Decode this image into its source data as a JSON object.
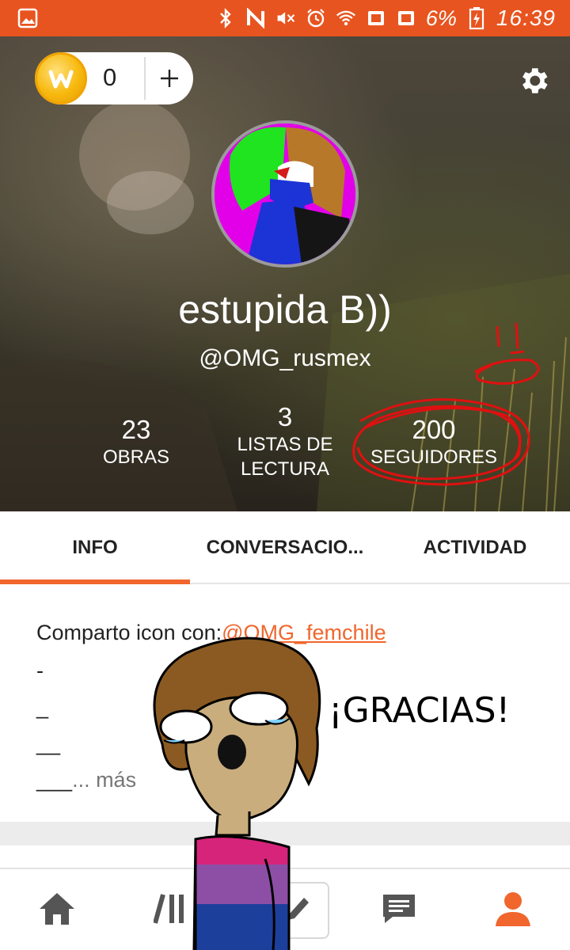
{
  "status_bar": {
    "battery": "6%",
    "time": "16:39",
    "icons": [
      "gallery-icon",
      "bluetooth-icon",
      "nfc-icon",
      "mute-icon",
      "alarm-icon",
      "wifi-icon",
      "sim1-icon",
      "sim2-icon",
      "battery-icon"
    ]
  },
  "wallet": {
    "coins": "0",
    "add_label": "+"
  },
  "profile": {
    "display_name": "estupida B))",
    "username": "@OMG_rusmex"
  },
  "stats": [
    {
      "value": "23",
      "label": "OBRAS"
    },
    {
      "value": "3",
      "label_line1": "LISTAS DE",
      "label_line2": "LECTURA"
    },
    {
      "value": "200",
      "label": "SEGUIDORES"
    }
  ],
  "tabs": [
    "INFO",
    "CONVERSACIO...",
    "ACTIVIDAD"
  ],
  "info": {
    "prefix": "Comparto icon con:",
    "mention": "@OMG_femchile",
    "lines": [
      "-",
      "_",
      "__",
      "___"
    ],
    "more": "... más"
  },
  "drawing_text": "¡GRACIAS!",
  "bottom_nav": [
    "home-icon",
    "library-icon",
    "write-icon",
    "messages-icon",
    "profile-icon"
  ],
  "colors": {
    "accent": "#f0662d",
    "status_bar": "#e8541f",
    "coin": "#f7b90e"
  }
}
